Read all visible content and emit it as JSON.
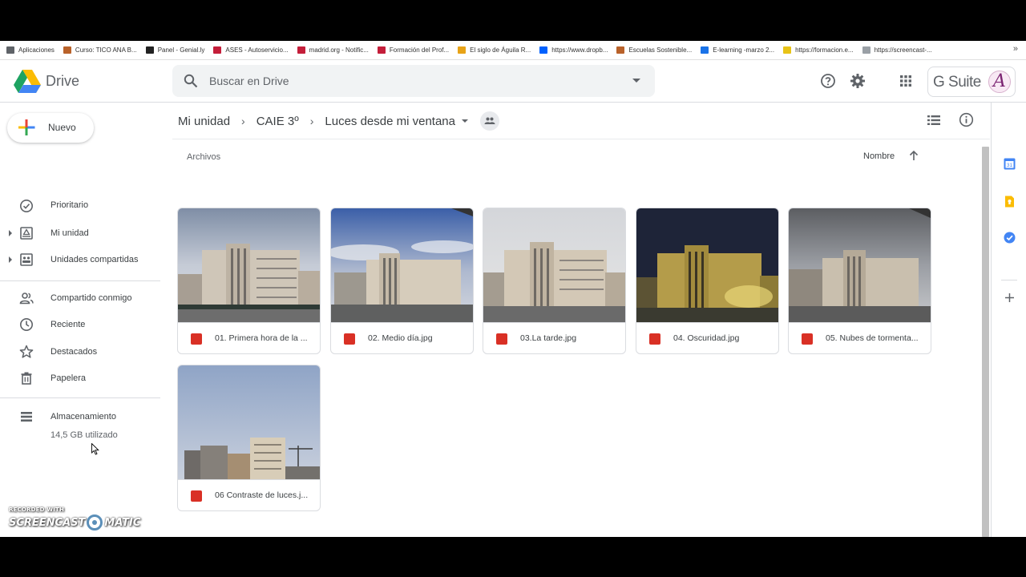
{
  "bookmarks": {
    "items": [
      {
        "label": "Aplicaciones",
        "color": "#5f6368"
      },
      {
        "label": "Curso: TICO ANA B...",
        "color": "#b9622a"
      },
      {
        "label": "Panel - Genial.ly",
        "color": "#222222"
      },
      {
        "label": "ASES - Autoservicio...",
        "color": "#c41e3a"
      },
      {
        "label": "madrid.org - Notific...",
        "color": "#c41e3a"
      },
      {
        "label": "Formación del Prof...",
        "color": "#c41e3a"
      },
      {
        "label": "El siglo de Águila R...",
        "color": "#e8a317"
      },
      {
        "label": "https://www.dropb...",
        "color": "#0061fe"
      },
      {
        "label": "Escuelas Sostenible...",
        "color": "#b9622a"
      },
      {
        "label": "E-learning -marzo 2...",
        "color": "#1a73e8"
      },
      {
        "label": "https://formacion.e...",
        "color": "#e8c317"
      },
      {
        "label": "https://screencast-...",
        "color": "#9aa0a6"
      }
    ],
    "more": "»"
  },
  "header": {
    "logo_text": "Drive",
    "search_placeholder": "Buscar en Drive",
    "gsuite_label": "G Suite",
    "avatar_letter": "A"
  },
  "sidebar": {
    "new_label": "Nuevo",
    "items": [
      {
        "label": "Prioritario"
      },
      {
        "label": "Mi unidad"
      },
      {
        "label": "Unidades compartidas"
      },
      {
        "label": "Compartido conmigo"
      },
      {
        "label": "Reciente"
      },
      {
        "label": "Destacados"
      },
      {
        "label": "Papelera"
      },
      {
        "label": "Almacenamiento"
      }
    ],
    "storage_used": "14,5 GB utilizado"
  },
  "main": {
    "breadcrumb": [
      "Mi unidad",
      "CAIE 3º",
      "Luces desde mi ventana"
    ],
    "section_label": "Archivos",
    "sort_label": "Nombre",
    "files": [
      {
        "name": "01. Primera hora de la ..."
      },
      {
        "name": "02. Medio día.jpg"
      },
      {
        "name": "03.La tarde.jpg"
      },
      {
        "name": "04. Oscuridad.jpg"
      },
      {
        "name": "05. Nubes de tormenta..."
      },
      {
        "name": "06 Contraste de luces.j..."
      }
    ]
  },
  "right_panel": {
    "calendar_day": "31"
  },
  "watermark": {
    "line1": "RECORDED WITH",
    "line2a": "SCREENCAST",
    "line2b": "MATIC"
  },
  "colors": {
    "accent_blue": "#1a73e8",
    "image_red": "#d93025",
    "text_dark": "#3c4043",
    "text_grey": "#5f6368"
  }
}
